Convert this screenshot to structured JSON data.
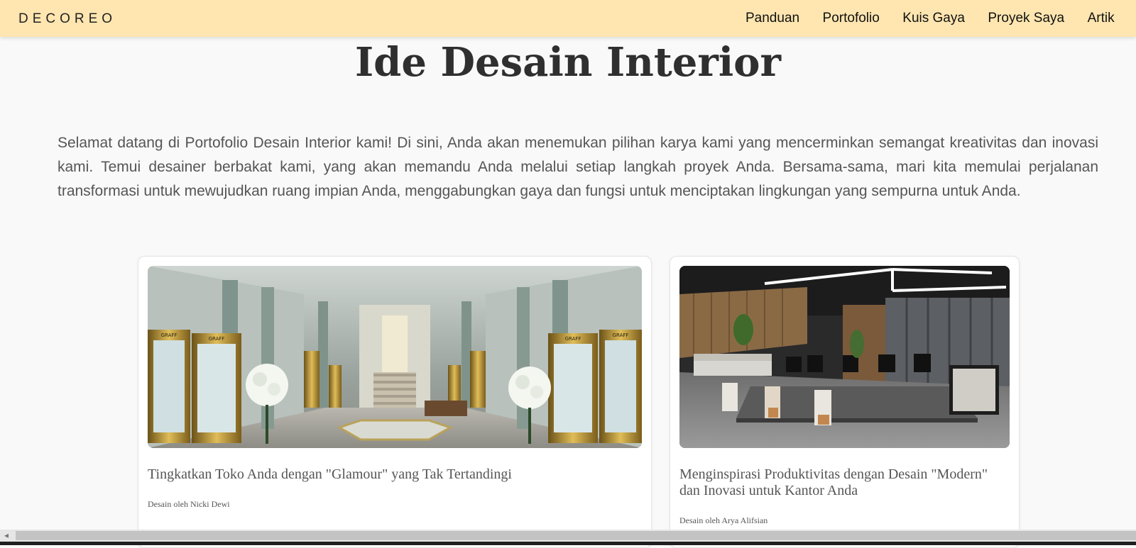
{
  "navbar": {
    "logo": "DECOREO",
    "links": [
      "Panduan",
      "Portofolio",
      "Kuis Gaya",
      "Proyek Saya",
      "Artik"
    ]
  },
  "page": {
    "title": "Ide Desain Interior",
    "intro": "Selamat datang di Portofolio Desain Interior kami! Di sini, Anda akan menemukan pilihan karya kami yang mencerminkan semangat kreativitas dan inovasi kami. Temui desainer berbakat kami, yang akan memandu Anda melalui setiap langkah proyek Anda. Bersama-sama, mari kita memulai perjalanan transformasi untuk mewujudkan ruang impian Anda, menggabungkan gaya dan fungsi untuk menciptakan lingkungan yang sempurna untuk Anda."
  },
  "cards": [
    {
      "title": "Tingkatkan Toko Anda dengan \"Glamour\" yang Tak Tertandingi",
      "designer": "Desain oleh Nicki Dewi",
      "signs": [
        "GRAFF",
        "GRAFF",
        "GRAFF",
        "GRAFF"
      ]
    },
    {
      "title": "Menginspirasi Produktivitas dengan Desain \"Modern\" dan Inovasi untuk Kantor Anda",
      "designer": "Desain oleh Arya Alifsian"
    }
  ],
  "colors": {
    "navbar_bg": "#ffe6b0",
    "page_bg": "#f9f9f9",
    "title": "#2f2f2f",
    "text": "#555555"
  },
  "icons": {
    "scroll_left": "chevron-left-icon"
  }
}
